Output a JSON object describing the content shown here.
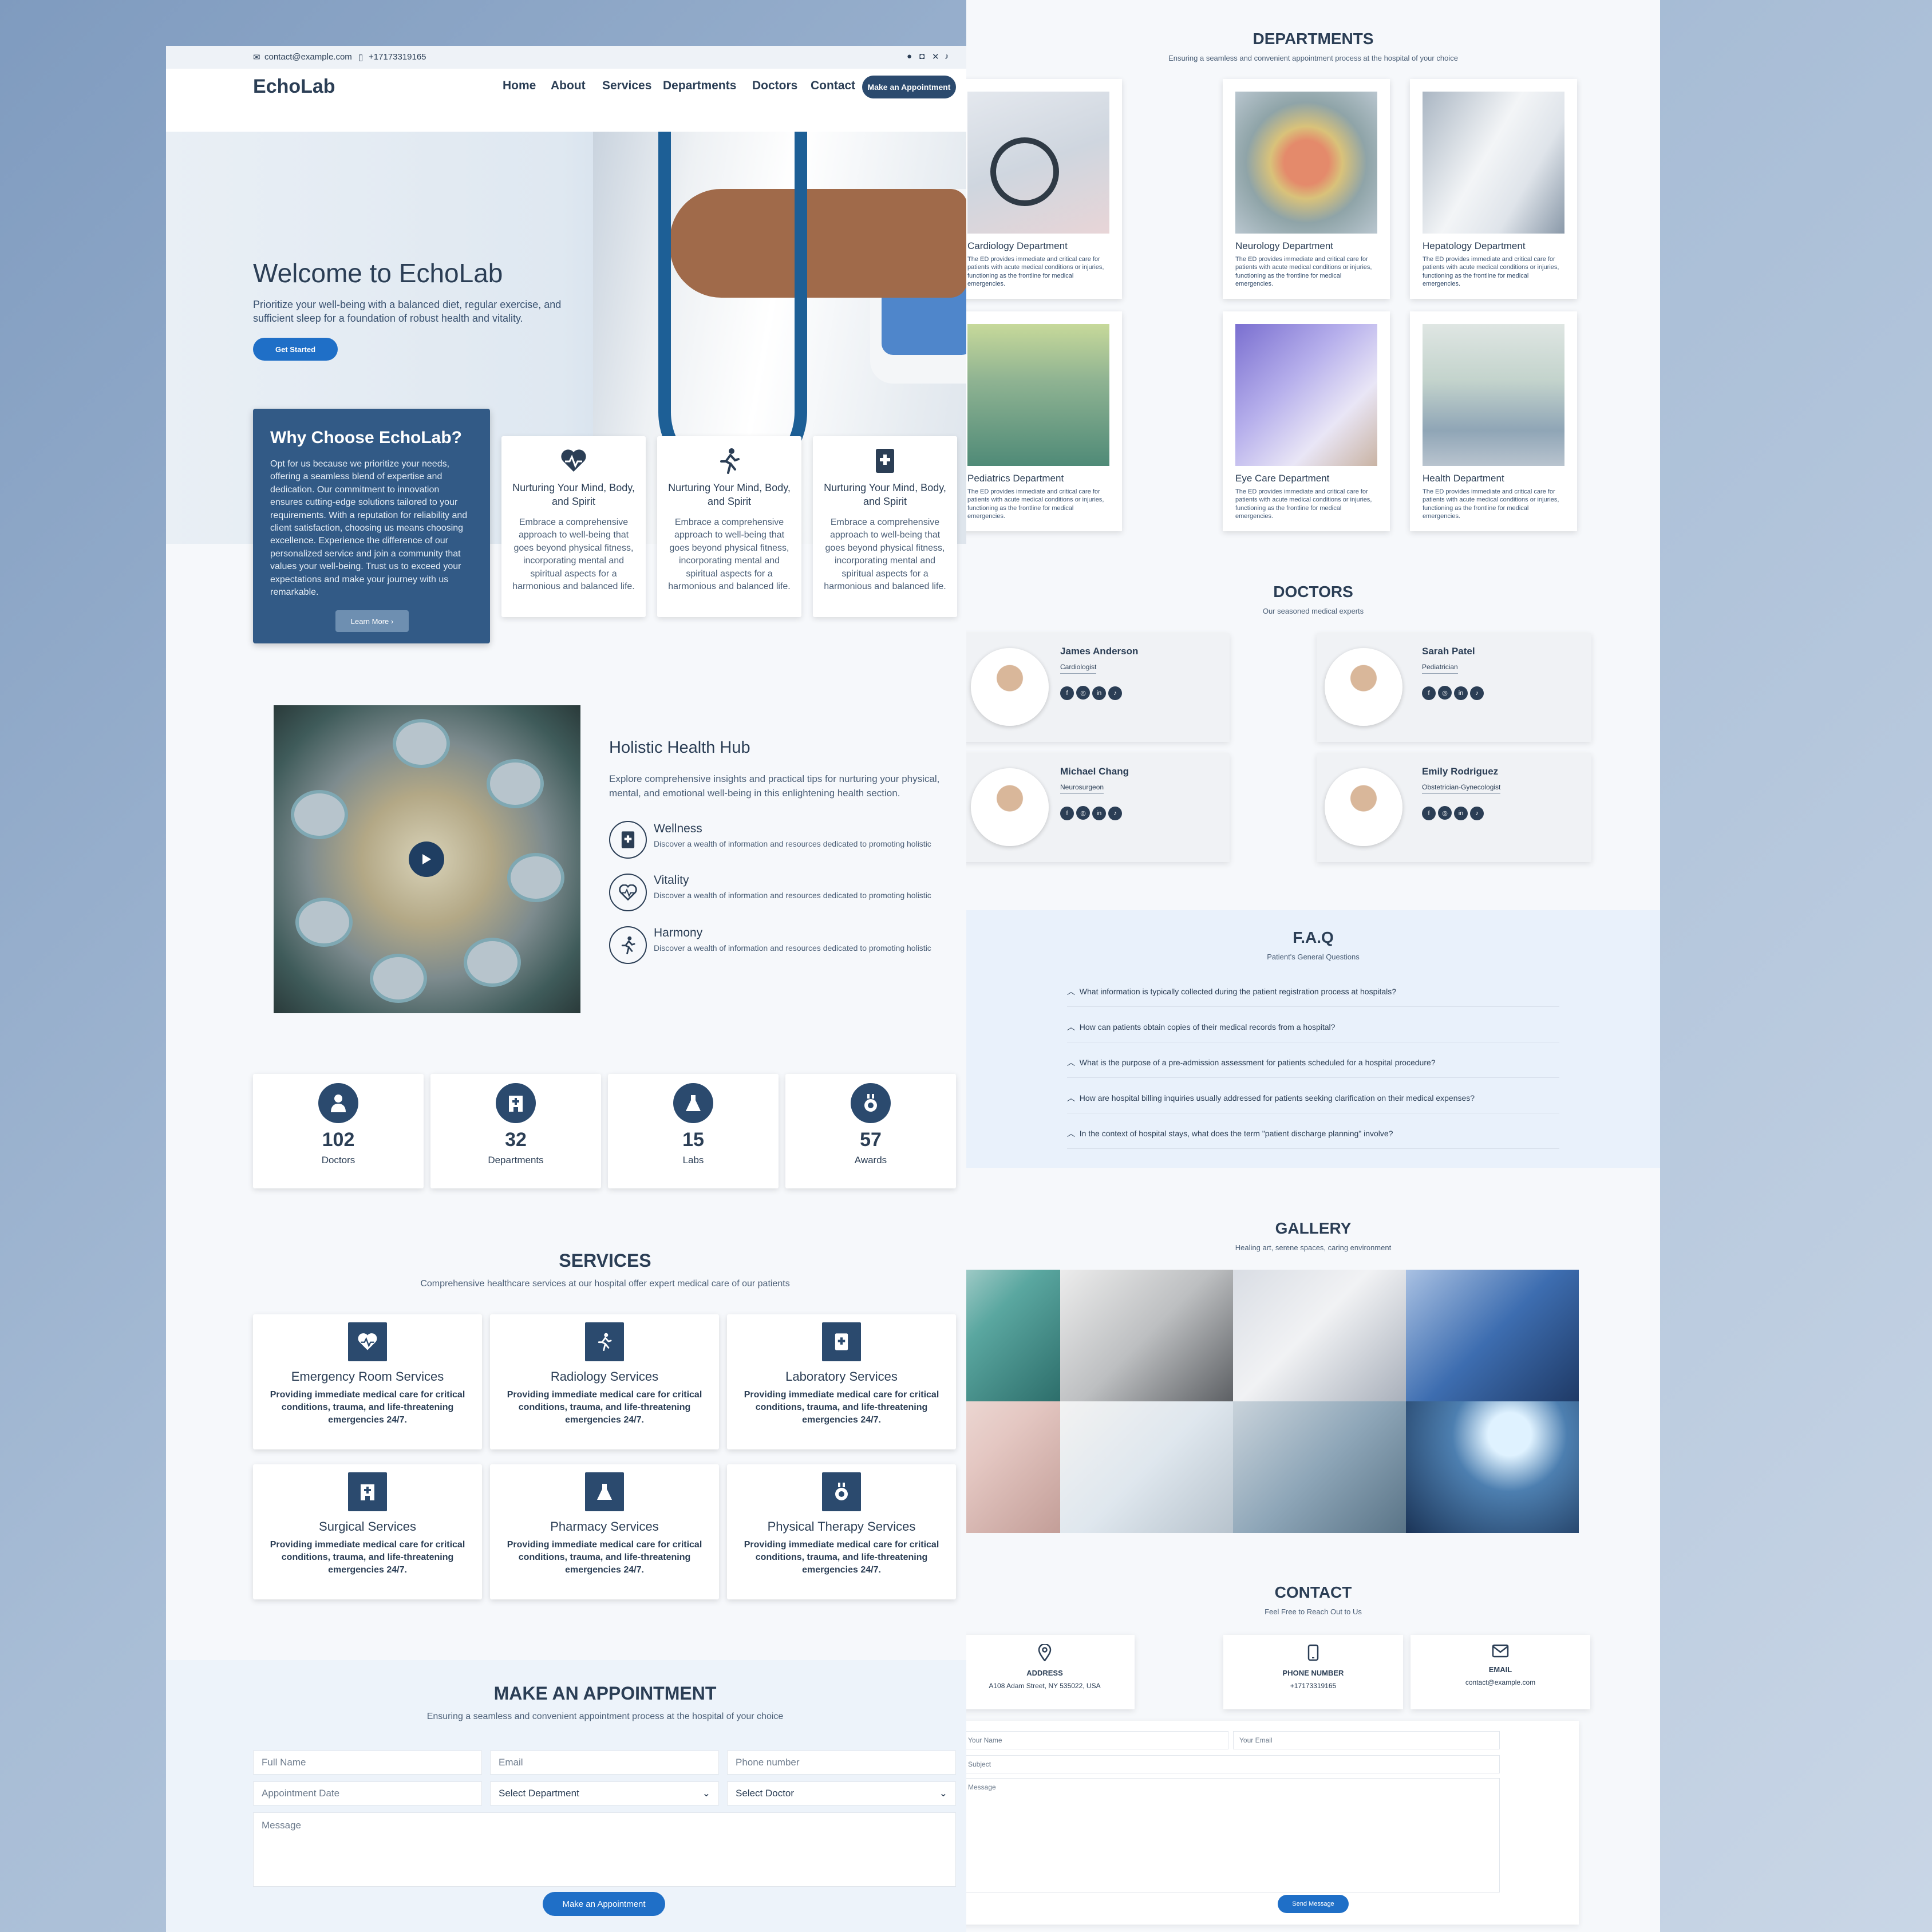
{
  "topbar": {
    "email": "contact@example.com",
    "phone": "+17173319165"
  },
  "brand": {
    "logo": "EchoLab"
  },
  "nav": {
    "items": [
      "Home",
      "About",
      "Services",
      "Departments",
      "Doctors",
      "Contact"
    ],
    "cta": "Make an Appointment"
  },
  "hero": {
    "title": "Welcome to EchoLab",
    "subtitle": "Prioritize your well-being with a balanced diet, regular exercise, and sufficient sleep for a foundation of robust health and vitality.",
    "cta": "Get Started"
  },
  "why": {
    "title": "Why Choose EchoLab?",
    "body": "Opt for us because we prioritize your needs, offering a seamless blend of expertise and dedication. Our commitment to innovation ensures cutting-edge solutions tailored to your requirements. With a reputation for reliability and client satisfaction, choosing us means choosing excellence. Experience the difference of our personalized service and join a community that values your well-being. Trust us to exceed your expectations and make your journey with us remarkable.",
    "cta": "Learn More"
  },
  "features": [
    {
      "icon": "heart-pulse-icon",
      "title": "Nurturing Your Mind, Body, and Spirit",
      "text": "Embrace a comprehensive approach to well-being that goes beyond physical fitness, incorporating mental and spiritual aspects for a harmonious and balanced life."
    },
    {
      "icon": "running-person-icon",
      "title": "Nurturing Your Mind, Body, and Spirit",
      "text": "Embrace a comprehensive approach to well-being that goes beyond physical fitness, incorporating mental and spiritual aspects for a harmonious and balanced life."
    },
    {
      "icon": "medical-book-icon",
      "title": "Nurturing Your Mind, Body, and Spirit",
      "text": "Embrace a comprehensive approach to well-being that goes beyond physical fitness, incorporating mental and spiritual aspects for a harmonious and balanced life."
    }
  ],
  "holistic": {
    "title": "Holistic Health Hub",
    "subtitle": "Explore comprehensive insights and practical tips for nurturing your physical, mental, and emotional well-being in this enlightening health section.",
    "items": [
      {
        "icon": "medical-book-icon",
        "title": "Wellness",
        "text": "Discover a wealth of information and resources dedicated to promoting holistic"
      },
      {
        "icon": "heart-pulse-icon",
        "title": "Vitality",
        "text": "Discover a wealth of information and resources dedicated to promoting holistic"
      },
      {
        "icon": "running-person-icon",
        "title": "Harmony",
        "text": "Discover a wealth of information and resources dedicated to promoting holistic"
      }
    ]
  },
  "stats": [
    {
      "icon": "user-doctor-icon",
      "value": "102",
      "label": "Doctors"
    },
    {
      "icon": "hospital-icon",
      "value": "32",
      "label": "Departments"
    },
    {
      "icon": "flask-icon",
      "value": "15",
      "label": "Labs"
    },
    {
      "icon": "award-icon",
      "value": "57",
      "label": "Awards"
    }
  ],
  "services": {
    "title": "SERVICES",
    "subtitle": "Comprehensive healthcare services at our hospital offer expert medical care of our patients",
    "items": [
      {
        "icon": "heart-pulse-icon",
        "title": "Emergency Room Services",
        "text": "Providing immediate medical care for critical conditions, trauma, and life-threatening emergencies 24/7."
      },
      {
        "icon": "running-person-icon",
        "title": "Radiology Services",
        "text": "Providing immediate medical care for critical conditions, trauma, and life-threatening emergencies 24/7."
      },
      {
        "icon": "medical-book-icon",
        "title": "Laboratory Services",
        "text": "Providing immediate medical care for critical conditions, trauma, and life-threatening emergencies 24/7."
      },
      {
        "icon": "hospital-icon",
        "title": "Surgical Services",
        "text": "Providing immediate medical care for critical conditions, trauma, and life-threatening emergencies 24/7."
      },
      {
        "icon": "flask-icon",
        "title": "Pharmacy Services",
        "text": "Providing immediate medical care for critical conditions, trauma, and life-threatening emergencies 24/7."
      },
      {
        "icon": "award-icon",
        "title": "Physical Therapy Services",
        "text": "Providing immediate medical care for critical conditions, trauma, and life-threatening emergencies 24/7."
      }
    ]
  },
  "appointment": {
    "title": "MAKE AN APPOINTMENT",
    "subtitle": "Ensuring a seamless and convenient appointment process at the hospital of your choice",
    "fullname_placeholder": "Full Name",
    "email_placeholder": "Email",
    "phone_placeholder": "Phone number",
    "date_placeholder": "Appointment Date",
    "department_selected": "Select Department",
    "doctor_selected": "Select Doctor",
    "message_placeholder": "Message",
    "submit": "Make an Appointment"
  },
  "departments": {
    "title": "DEPARTMENTS",
    "subtitle": "Ensuring a seamless and convenient appointment process at the hospital of your choice",
    "items": [
      {
        "title": "Cardiology Department",
        "text": "The ED provides immediate and critical care for patients with acute medical conditions or injuries, functioning as the frontline for medical emergencies."
      },
      {
        "title": "Neurology Department",
        "text": "The ED provides immediate and critical care for patients with acute medical conditions or injuries, functioning as the frontline for medical emergencies."
      },
      {
        "title": "Hepatology Department",
        "text": "The ED provides immediate and critical care for patients with acute medical conditions or injuries, functioning as the frontline for medical emergencies."
      },
      {
        "title": "Pediatrics Department",
        "text": "The ED provides immediate and critical care for patients with acute medical conditions or injuries, functioning as the frontline for medical emergencies."
      },
      {
        "title": "Eye Care Department",
        "text": "The ED provides immediate and critical care for patients with acute medical conditions or injuries, functioning as the frontline for medical emergencies."
      },
      {
        "title": "Health Department",
        "text": "The ED provides immediate and critical care for patients with acute medical conditions or injuries, functioning as the frontline for medical emergencies."
      }
    ]
  },
  "doctors": {
    "title": "DOCTORS",
    "subtitle": "Our seasoned medical experts",
    "items": [
      {
        "name": "James Anderson",
        "role": "Cardiologist"
      },
      {
        "name": "Sarah Patel",
        "role": "Pediatrician"
      },
      {
        "name": "Michael Chang",
        "role": "Neurosurgeon"
      },
      {
        "name": "Emily Rodriguez",
        "role": "Obstetrician-Gynecologist"
      }
    ]
  },
  "faq": {
    "title": "F.A.Q",
    "subtitle": "Patient's General Questions",
    "items": [
      "What information is typically collected during the patient registration process at hospitals?",
      "How can patients obtain copies of their medical records from a hospital?",
      "What is the purpose of a pre-admission assessment for patients scheduled for a hospital procedure?",
      "How are hospital billing inquiries usually addressed for patients seeking clarification on their medical expenses?",
      "In the context of hospital stays, what does the term \"patient discharge planning\" involve?"
    ]
  },
  "gallery": {
    "title": "GALLERY",
    "subtitle": "Healing art, serene spaces, caring environment"
  },
  "contact": {
    "title": "CONTACT",
    "subtitle": "Feel Free to Reach Out to Us",
    "cards": [
      {
        "icon": "map-pin-icon",
        "title": "ADDRESS",
        "value": "A108 Adam Street, NY 535022, USA"
      },
      {
        "icon": "phone-icon",
        "title": "PHONE NUMBER",
        "value": "+17173319165"
      },
      {
        "icon": "envelope-icon",
        "title": "EMAIL",
        "value": "contact@example.com"
      }
    ],
    "name_placeholder": "Your Name",
    "email_placeholder": "Your Email",
    "subject_placeholder": "Subject",
    "message_placeholder": "Message",
    "submit": "Send Message"
  },
  "colors": {
    "navy": "#2b4a6e",
    "accent": "#1f6fc7",
    "panel": "#325a86"
  }
}
